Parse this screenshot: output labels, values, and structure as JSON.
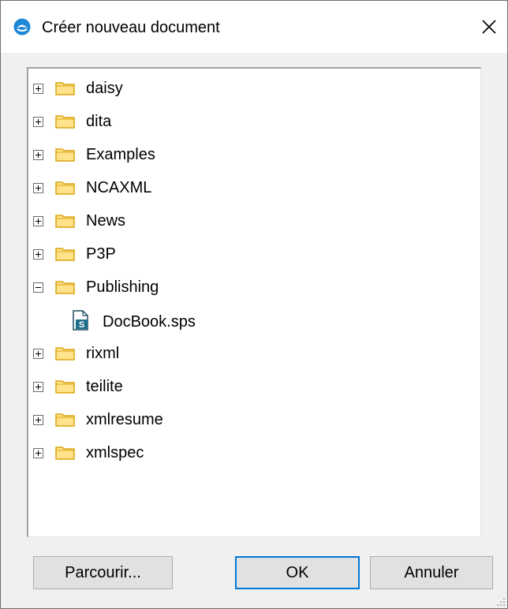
{
  "window": {
    "title": "Créer nouveau document",
    "app_icon": "altova-logo-icon",
    "close_icon": "close-icon",
    "close_glyph": "✕"
  },
  "tree": {
    "items": [
      {
        "label": "daisy",
        "type": "folder",
        "expanded": false
      },
      {
        "label": "dita",
        "type": "folder",
        "expanded": false
      },
      {
        "label": "Examples",
        "type": "folder",
        "expanded": false
      },
      {
        "label": "NCAXML",
        "type": "folder",
        "expanded": false
      },
      {
        "label": "News",
        "type": "folder",
        "expanded": false
      },
      {
        "label": "P3P",
        "type": "folder",
        "expanded": false
      },
      {
        "label": "Publishing",
        "type": "folder",
        "expanded": true,
        "children": [
          {
            "label": "DocBook.sps",
            "type": "file",
            "icon_letter": "S"
          }
        ]
      },
      {
        "label": "rixml",
        "type": "folder",
        "expanded": false
      },
      {
        "label": "teilite",
        "type": "folder",
        "expanded": false
      },
      {
        "label": "xmlresume",
        "type": "folder",
        "expanded": false
      },
      {
        "label": "xmlspec",
        "type": "folder",
        "expanded": false
      }
    ]
  },
  "buttons": {
    "browse_label": "Parcourir...",
    "ok_label": "OK",
    "cancel_label": "Annuler"
  },
  "colors": {
    "folder_fill": "#ffe28a",
    "folder_stroke": "#d9a514",
    "accent": "#0078d7",
    "file_icon": "#1f6f8b"
  }
}
